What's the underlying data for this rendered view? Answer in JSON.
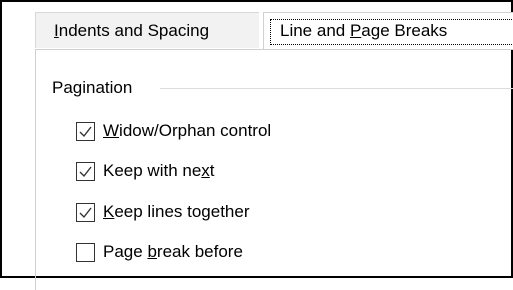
{
  "tabs": [
    {
      "pre": "",
      "key": "I",
      "post": "ndents and Spacing",
      "active": false
    },
    {
      "pre": "Line and ",
      "key": "P",
      "post": "age Breaks",
      "active": true
    }
  ],
  "pagination": {
    "title": "Pagination",
    "options": [
      {
        "pre": "",
        "key": "W",
        "post": "idow/Orphan control",
        "checked": true
      },
      {
        "pre": "Keep with ne",
        "key": "x",
        "post": "t",
        "checked": true
      },
      {
        "pre": "",
        "key": "K",
        "post": "eep lines together",
        "checked": true
      },
      {
        "pre": "Page ",
        "key": "b",
        "post": "reak before",
        "checked": false
      }
    ]
  },
  "colors": {
    "inactive_tab_bg": "#f2f2f2",
    "checkmark": "#333333"
  },
  "icons": {
    "checkmark": "checkmark-icon"
  }
}
